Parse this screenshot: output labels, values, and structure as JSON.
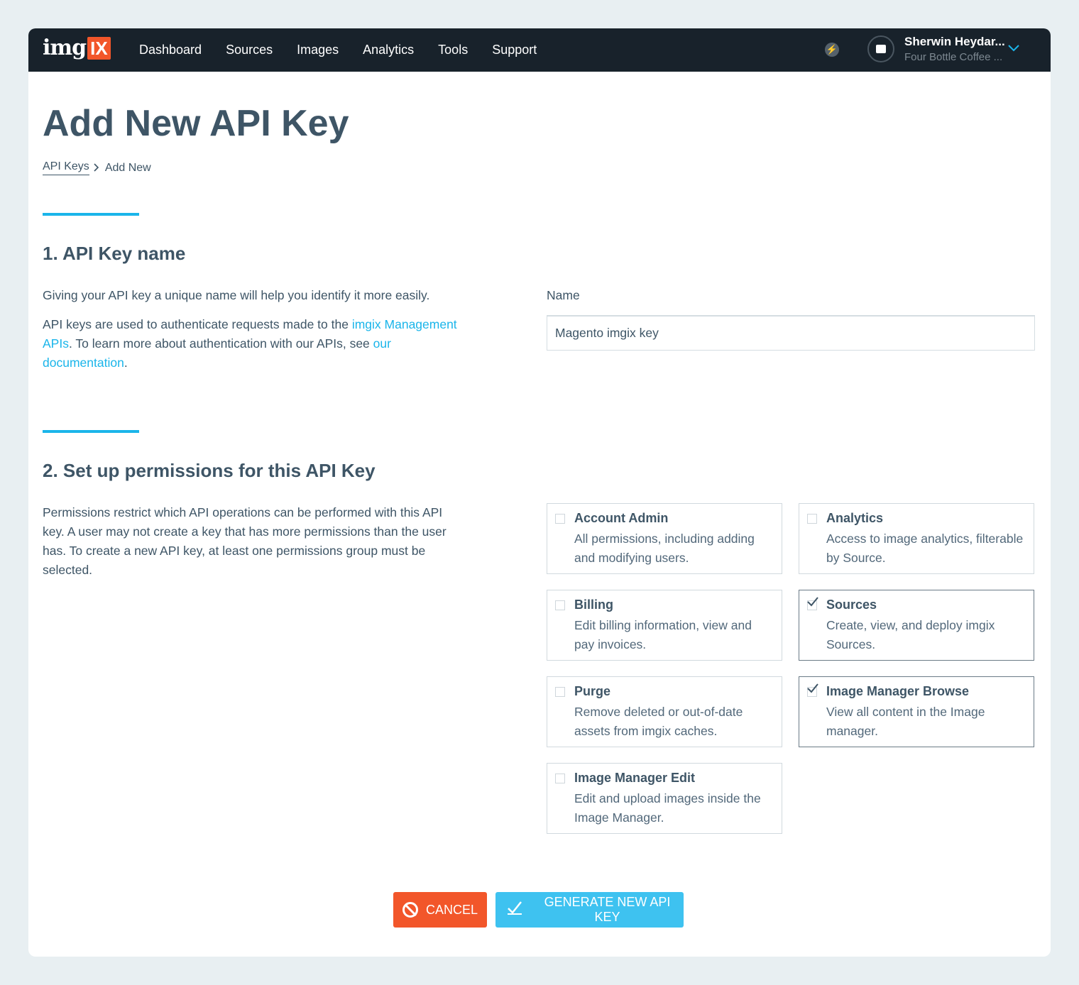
{
  "nav": {
    "logo_text": "img",
    "logo_badge": "IX",
    "links": [
      "Dashboard",
      "Sources",
      "Images",
      "Analytics",
      "Tools",
      "Support"
    ],
    "user_name": "Sherwin Heydar...",
    "user_org": "Four Bottle Coffee ..."
  },
  "page": {
    "title": "Add New API Key",
    "breadcrumb": {
      "parent": "API Keys",
      "current": "Add New"
    }
  },
  "section1": {
    "title": "1. API Key name",
    "intro": "Giving your API key a unique name will help you identify it more easily.",
    "desc_pre": "API keys are used to authenticate requests made to the ",
    "desc_link1": "imgix Management APIs",
    "desc_mid": ". To learn more about authentication with our APIs, see ",
    "desc_link2": "our documentation",
    "desc_post": ".",
    "field_label": "Name",
    "field_value": "Magento imgix key"
  },
  "section2": {
    "title": "2. Set up permissions for this API Key",
    "desc": "Permissions restrict which API operations can be performed with this API key. A user may not create a key that has more permissions than the user has. To create a new API key, at least one permissions group must be selected.",
    "permissions": [
      {
        "title": "Account Admin",
        "desc": "All permissions, including adding and modifying users.",
        "checked": false
      },
      {
        "title": "Analytics",
        "desc": "Access to image analytics, filterable by Source.",
        "checked": false
      },
      {
        "title": "Billing",
        "desc": "Edit billing information, view and pay invoices.",
        "checked": false
      },
      {
        "title": "Sources",
        "desc": "Create, view, and deploy imgix Sources.",
        "checked": true
      },
      {
        "title": "Purge",
        "desc": "Remove deleted or out-of-date assets from imgix caches.",
        "checked": false
      },
      {
        "title": "Image Manager Browse",
        "desc": "View all content in the Image manager.",
        "checked": true
      },
      {
        "title": "Image Manager Edit",
        "desc": "Edit and upload images inside the Image Manager.",
        "checked": false
      }
    ]
  },
  "actions": {
    "cancel_label": "CANCEL",
    "generate_label": "GENERATE NEW API KEY"
  },
  "colors": {
    "accent": "#1ab5ea",
    "cancel": "#f2562a",
    "generate": "#3ec2f0",
    "nav_bg": "#18222b"
  }
}
